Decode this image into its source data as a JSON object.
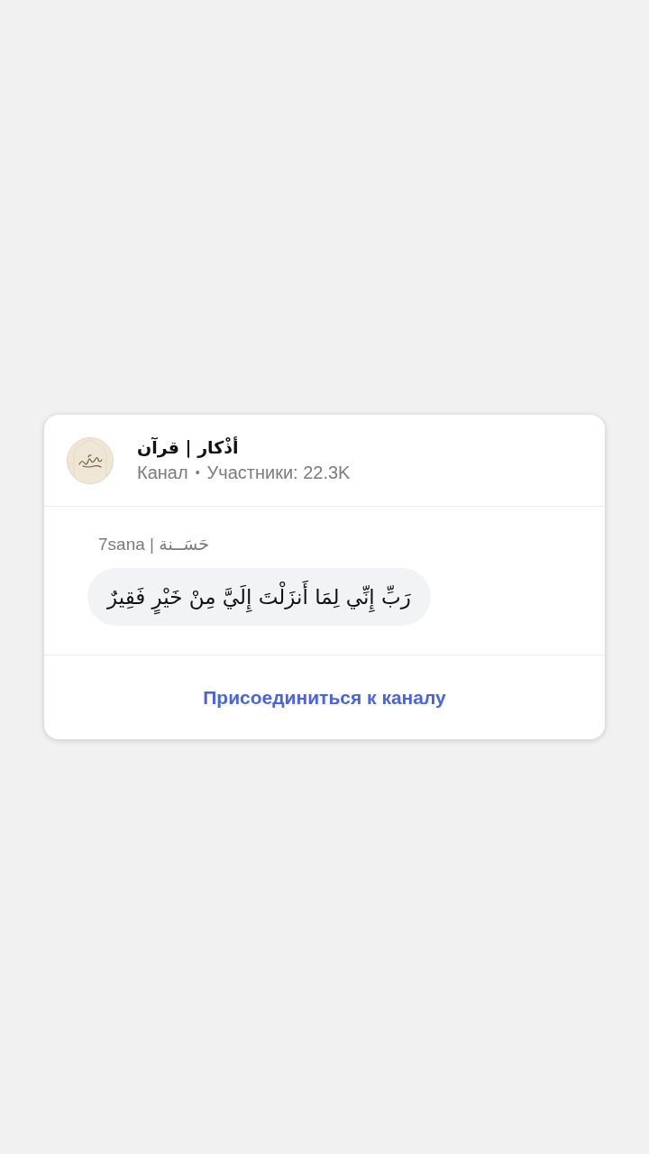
{
  "channel": {
    "title": "أذْكار | قرآن",
    "type": "Канал",
    "separator": "•",
    "members": "Участники: 22.3K"
  },
  "message": {
    "sender": "7sana | حَسَــنة",
    "text": "رَبِّ إِنِّي لِمَا أَنزَلْتَ إِلَيَّ مِنْ خَيْرٍ فَقِيرٌ"
  },
  "join_button": {
    "label": "Присоединиться к каналу"
  }
}
